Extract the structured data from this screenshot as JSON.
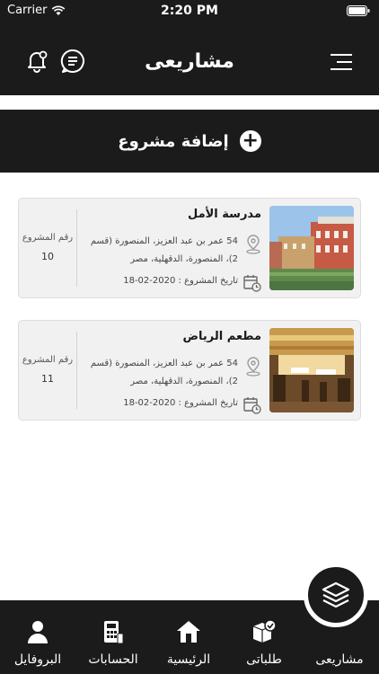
{
  "status": {
    "carrier": "Carrier",
    "time": "2:20 PM"
  },
  "header": {
    "title": "مشاريعى"
  },
  "add_project": {
    "label": "إضافة مشروع"
  },
  "projects": [
    {
      "name": "مدرسة الأمل",
      "address": "54 عمر بن عبد العزيز، المنصورة (قسم 2)، المنصورة، الدقهلية، مصر",
      "date": "تاريخ المشروع : 2020-02-18",
      "number_label": "رقم المشروع",
      "number": "10"
    },
    {
      "name": "مطعم الرياض",
      "address": "54 عمر بن عبد العزيز، المنصورة (قسم 2)، المنصورة، الدقهلية، مصر",
      "date": "تاريخ المشروع : 2020-02-18",
      "number_label": "رقم المشروع",
      "number": "11"
    }
  ],
  "tabs": [
    {
      "label": "مشاريعى",
      "icon": "layers-icon",
      "active": true
    },
    {
      "label": "طلباتى",
      "icon": "box-check-icon"
    },
    {
      "label": "الرئيسية",
      "icon": "home-icon"
    },
    {
      "label": "الحسابات",
      "icon": "calculator-icon"
    },
    {
      "label": "البروفايل",
      "icon": "user-icon"
    }
  ]
}
